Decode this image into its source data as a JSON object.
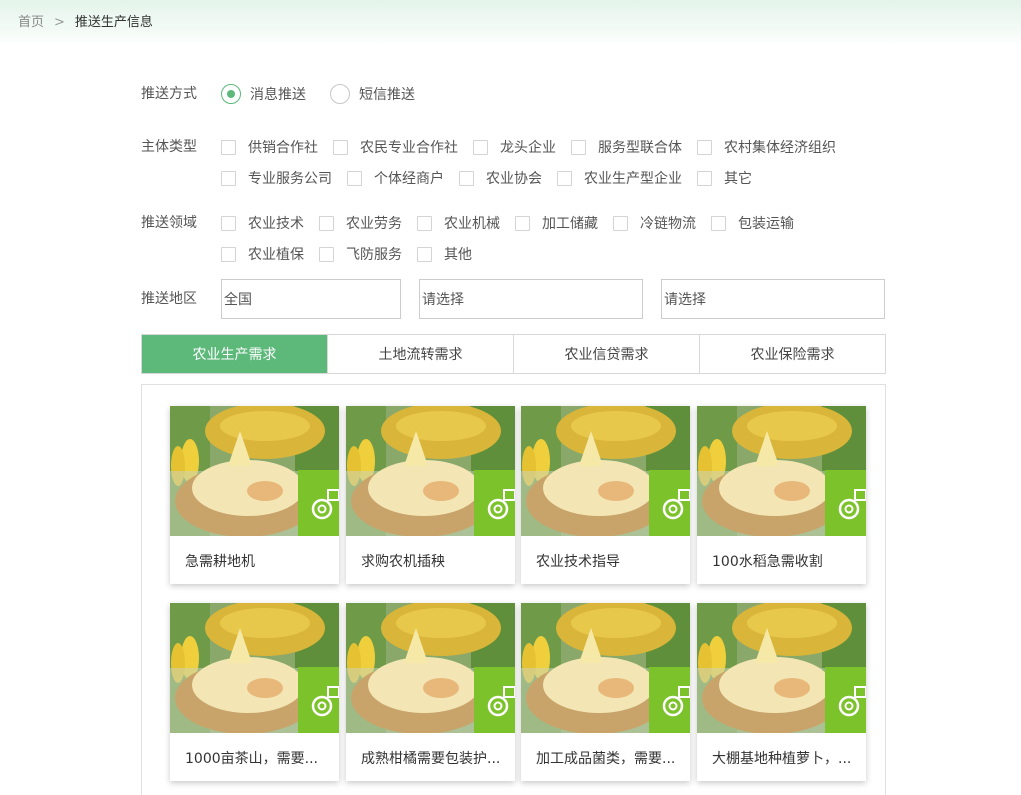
{
  "breadcrumb": {
    "home": "首页",
    "separator": ">",
    "current": "推送生产信息"
  },
  "push_method": {
    "label": "推送方式",
    "options": [
      {
        "label": "消息推送",
        "selected": true
      },
      {
        "label": "短信推送",
        "selected": false
      }
    ]
  },
  "entity_type": {
    "label": "主体类型",
    "options": [
      "供销合作社",
      "农民专业合作社",
      "龙头企业",
      "服务型联合体",
      "农村集体经济组织",
      "专业服务公司",
      "个体经商户",
      "农业协会",
      "农业生产型企业",
      "其它"
    ]
  },
  "push_field": {
    "label": "推送领域",
    "options": [
      "农业技术",
      "农业劳务",
      "农业机械",
      "加工储藏",
      "冷链物流",
      "包装运输",
      "农业植保",
      "飞防服务",
      "其他"
    ]
  },
  "region": {
    "label": "推送地区",
    "province": "全国",
    "city": "请选择",
    "district": "请选择"
  },
  "tabs": [
    {
      "label": "农业生产需求",
      "active": true
    },
    {
      "label": "土地流转需求",
      "active": false
    },
    {
      "label": "农业信贷需求",
      "active": false
    },
    {
      "label": "农业保险需求",
      "active": false
    }
  ],
  "cards": [
    {
      "title": "急需耕地机"
    },
    {
      "title": "求购农机插秧"
    },
    {
      "title": "农业技术指导"
    },
    {
      "title": "100水稻急需收割"
    },
    {
      "title": "1000亩茶山，需要..."
    },
    {
      "title": "成熟柑橘需要包装护..."
    },
    {
      "title": "加工成品菌类，需要..."
    },
    {
      "title": "大棚基地种植萝卜，..."
    }
  ],
  "colors": {
    "accent": "#5cb97a",
    "icon_green": "#7cc22a"
  }
}
